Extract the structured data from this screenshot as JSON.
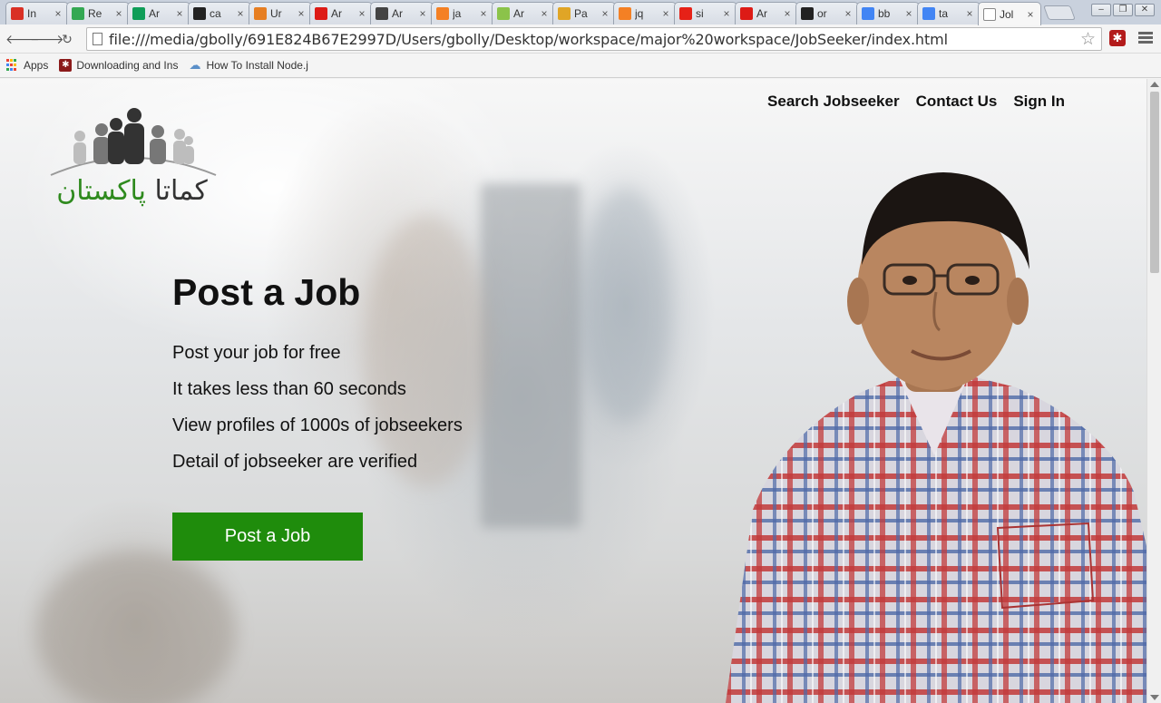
{
  "browser": {
    "tabs": [
      {
        "icon": "gmail-icon",
        "title": "In",
        "color": "#d93025"
      },
      {
        "icon": "google-drive-icon",
        "title": "Re",
        "color": "#34a853"
      },
      {
        "icon": "google-sheets-icon",
        "title": "Ar",
        "color": "#0f9d58"
      },
      {
        "icon": "github-icon",
        "title": "ca",
        "color": "#222222"
      },
      {
        "icon": "sitepoint-icon",
        "title": "Ur",
        "color": "#e67e22"
      },
      {
        "icon": "angular-icon",
        "title": "Ar",
        "color": "#dd1b16"
      },
      {
        "icon": "glasses-icon",
        "title": "Ar",
        "color": "#444444"
      },
      {
        "icon": "stackoverflow-icon",
        "title": "ja",
        "color": "#f48024"
      },
      {
        "icon": "egghead-icon",
        "title": "Ar",
        "color": "#8bc34a"
      },
      {
        "icon": "character-icon",
        "title": "Pa",
        "color": "#e0a526"
      },
      {
        "icon": "stackoverflow-icon",
        "title": "jq",
        "color": "#f48024"
      },
      {
        "icon": "youtube-icon",
        "title": "si",
        "color": "#e62117"
      },
      {
        "icon": "angular-icon",
        "title": "Ar",
        "color": "#dd1b16"
      },
      {
        "icon": "github-icon",
        "title": "or",
        "color": "#222222"
      },
      {
        "icon": "google-search-icon",
        "title": "bb",
        "color": "#4285f4"
      },
      {
        "icon": "google-search-icon",
        "title": "ta",
        "color": "#4285f4"
      },
      {
        "icon": "page-icon",
        "title": "Jol",
        "color": "#ffffff",
        "active": true
      }
    ],
    "url": "file:///media/gbolly/691E824B67E2997D/Users/gbolly/Desktop/workspace/major%20workspace/JobSeeker/index.html",
    "bookmarks": {
      "apps": "Apps",
      "item1": "Downloading and Ins",
      "item2": "How To Install Node.j"
    }
  },
  "page": {
    "nav": {
      "search": "Search Jobseeker",
      "contact": "Contact Us",
      "signin": "Sign In"
    },
    "logo": {
      "part_dark": "کماتا",
      "part_green": "پاکستان"
    },
    "hero": {
      "title": "Post a Job",
      "points": [
        "Post your job for free",
        "It takes less than 60 seconds",
        "View profiles of 1000s of jobseekers",
        "Detail of jobseeker are verified"
      ],
      "cta": "Post a Job"
    },
    "colors": {
      "cta": "#1f8c0c",
      "logo_green": "#2f8a1e"
    }
  }
}
